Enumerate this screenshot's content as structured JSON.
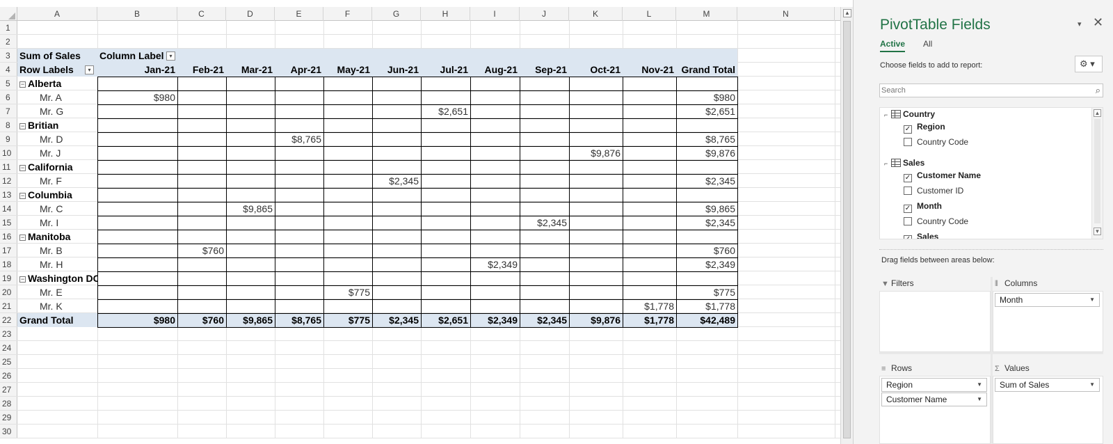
{
  "sheet": {
    "columns": [
      "A",
      "B",
      "C",
      "D",
      "E",
      "F",
      "G",
      "H",
      "I",
      "J",
      "K",
      "L",
      "M",
      "N"
    ],
    "rows": [
      "1",
      "2",
      "3",
      "4",
      "5",
      "6",
      "7",
      "8",
      "9",
      "10",
      "11",
      "12",
      "13",
      "14",
      "15",
      "16",
      "17",
      "18",
      "19",
      "20",
      "21",
      "22",
      "23",
      "24",
      "25",
      "26",
      "27",
      "28",
      "29",
      "30"
    ]
  },
  "pivot": {
    "corner_label": "Sum of Sales",
    "column_labels_header": "Column Label",
    "row_labels_header": "Row Labels",
    "months": [
      "Jan-21",
      "Feb-21",
      "Mar-21",
      "Apr-21",
      "May-21",
      "Jun-21",
      "Jul-21",
      "Aug-21",
      "Sep-21",
      "Oct-21",
      "Nov-21"
    ],
    "grand_total_col": "Grand Total",
    "rows": [
      {
        "label": "Alberta",
        "group": true,
        "cells": [
          "",
          "",
          "",
          "",
          "",
          "",
          "",
          "",
          "",
          "",
          "",
          ""
        ]
      },
      {
        "label": "Mr. A",
        "group": false,
        "cells": [
          "$980",
          "",
          "",
          "",
          "",
          "",
          "",
          "",
          "",
          "",
          "",
          "$980"
        ]
      },
      {
        "label": "Mr. G",
        "group": false,
        "cells": [
          "",
          "",
          "",
          "",
          "",
          "",
          "$2,651",
          "",
          "",
          "",
          "",
          "$2,651"
        ]
      },
      {
        "label": "Britian",
        "group": true,
        "cells": [
          "",
          "",
          "",
          "",
          "",
          "",
          "",
          "",
          "",
          "",
          "",
          ""
        ]
      },
      {
        "label": "Mr. D",
        "group": false,
        "cells": [
          "",
          "",
          "",
          "$8,765",
          "",
          "",
          "",
          "",
          "",
          "",
          "",
          "$8,765"
        ]
      },
      {
        "label": "Mr. J",
        "group": false,
        "cells": [
          "",
          "",
          "",
          "",
          "",
          "",
          "",
          "",
          "",
          "$9,876",
          "",
          "$9,876"
        ]
      },
      {
        "label": "California",
        "group": true,
        "cells": [
          "",
          "",
          "",
          "",
          "",
          "",
          "",
          "",
          "",
          "",
          "",
          ""
        ]
      },
      {
        "label": "Mr. F",
        "group": false,
        "cells": [
          "",
          "",
          "",
          "",
          "",
          "$2,345",
          "",
          "",
          "",
          "",
          "",
          "$2,345"
        ]
      },
      {
        "label": "Columbia",
        "group": true,
        "cells": [
          "",
          "",
          "",
          "",
          "",
          "",
          "",
          "",
          "",
          "",
          "",
          ""
        ]
      },
      {
        "label": "Mr. C",
        "group": false,
        "cells": [
          "",
          "",
          "$9,865",
          "",
          "",
          "",
          "",
          "",
          "",
          "",
          "",
          "$9,865"
        ]
      },
      {
        "label": "Mr. I",
        "group": false,
        "cells": [
          "",
          "",
          "",
          "",
          "",
          "",
          "",
          "",
          "$2,345",
          "",
          "",
          "$2,345"
        ]
      },
      {
        "label": "Manitoba",
        "group": true,
        "cells": [
          "",
          "",
          "",
          "",
          "",
          "",
          "",
          "",
          "",
          "",
          "",
          ""
        ]
      },
      {
        "label": "Mr. B",
        "group": false,
        "cells": [
          "",
          "$760",
          "",
          "",
          "",
          "",
          "",
          "",
          "",
          "",
          "",
          "$760"
        ]
      },
      {
        "label": "Mr. H",
        "group": false,
        "cells": [
          "",
          "",
          "",
          "",
          "",
          "",
          "",
          "$2,349",
          "",
          "",
          "",
          "$2,349"
        ]
      },
      {
        "label": "Washington DC",
        "group": true,
        "cells": [
          "",
          "",
          "",
          "",
          "",
          "",
          "",
          "",
          "",
          "",
          "",
          ""
        ]
      },
      {
        "label": "Mr. E",
        "group": false,
        "cells": [
          "",
          "",
          "",
          "",
          "$775",
          "",
          "",
          "",
          "",
          "",
          "",
          "$775"
        ]
      },
      {
        "label": "Mr. K",
        "group": false,
        "cells": [
          "",
          "",
          "",
          "",
          "",
          "",
          "",
          "",
          "",
          "",
          "$1,778",
          "$1,778"
        ]
      }
    ],
    "grand_total_row": {
      "label": "Grand Total",
      "cells": [
        "$980",
        "$760",
        "$9,865",
        "$8,765",
        "$775",
        "$2,345",
        "$2,651",
        "$2,349",
        "$2,345",
        "$9,876",
        "$1,778",
        "$42,489"
      ]
    },
    "collapse_glyph": "⊟"
  },
  "pane": {
    "title": "PivotTable Fields",
    "menu_glyph": "▾",
    "close_glyph": "✕",
    "tabs": {
      "active": "Active",
      "all": "All"
    },
    "choose_label": "Choose fields to add to report:",
    "gear_glyph": "⚙ ▾",
    "search_placeholder": "Search",
    "search_glyph": "⌕",
    "tables": [
      {
        "name": "Country",
        "fields": [
          {
            "name": "Region",
            "checked": true
          },
          {
            "name": "Country Code",
            "checked": false
          }
        ]
      },
      {
        "name": "Sales",
        "fields": [
          {
            "name": "Customer Name",
            "checked": true
          },
          {
            "name": "Customer ID",
            "checked": false
          },
          {
            "name": "Month",
            "checked": true
          },
          {
            "name": "Country Code",
            "checked": false
          },
          {
            "name": "Sales",
            "checked": true
          }
        ]
      }
    ],
    "check_glyph": "✓",
    "drag_label": "Drag fields between areas below:",
    "areas": {
      "filters": {
        "title": "Filters",
        "glyph": "▼",
        "items": []
      },
      "columns": {
        "title": "Columns",
        "glyph": "⦀",
        "items": [
          "Month"
        ]
      },
      "rows": {
        "title": "Rows",
        "glyph": "≡",
        "items": [
          "Region",
          "Customer Name"
        ]
      },
      "values": {
        "title": "Values",
        "glyph": "Σ",
        "items": [
          "Sum of Sales"
        ]
      }
    },
    "pill_glyph": "▼"
  }
}
